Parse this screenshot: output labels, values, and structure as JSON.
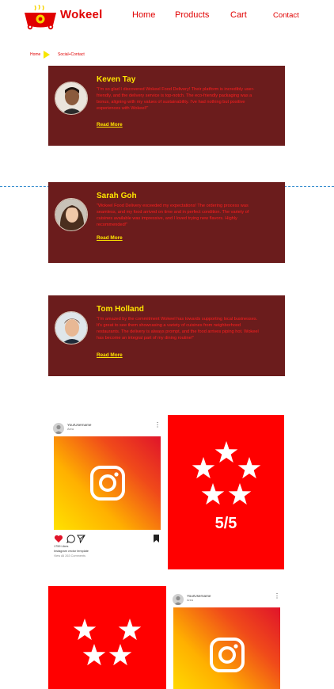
{
  "brand": {
    "name": "Wokeel",
    "accent": "#e00000",
    "card_bg": "#6b1c1c",
    "highlight": "#ffe600"
  },
  "nav": {
    "home": "Home",
    "products": "Products",
    "cart": "Cart",
    "contact": "Contact"
  },
  "breadcrumb": {
    "home": "Home",
    "current": "Social+Contact"
  },
  "testimonials": [
    {
      "name": "Keven Tay",
      "text": "\"I'm so glad I discovered Wokeel Food Delivery! Their platform is incredibly user-friendly, and the delivery service is top-notch. The eco-friendly packaging was a bonus, aligning with my values of sustainability. I've had nothing but positive experiences with Wokeel!\"",
      "more": "Read More"
    },
    {
      "name": "Sarah Goh",
      "text": "\"Wokeel Food Delivery exceeded my expectations! The ordering process was seamless, and my food arrived on time and in perfect condition. The variety of cuisines available was impressive, and I loved trying new flavors. Highly recommended!\"",
      "more": "Read More"
    },
    {
      "name": "Tom Holland",
      "text": "\"I'm amazed by the commitment Wokeel has towards supporting local businesses. It's great to see them showcasing a variety of cuisines from neighborhood restaurants. The delivery is always prompt, and the food arrives piping hot. Wokeel has become an integral part of my dining routine!\"",
      "more": "Read More"
    }
  ],
  "instagram": {
    "username": "YourUsername",
    "subtitle": "Area",
    "likes": "1759 Likes",
    "caption": "Instagram vector template",
    "comments": "View All 263 Comments"
  },
  "rating": {
    "label": "5/5",
    "value": 5,
    "max": 5
  },
  "icons": {
    "logo": "wok-pot-logo",
    "arrow": "breadcrumb-arrow-icon",
    "instagram": "instagram-icon",
    "heart": "heart-icon",
    "comment": "comment-icon",
    "share": "share-icon",
    "bookmark": "bookmark-icon",
    "star": "star-icon"
  }
}
